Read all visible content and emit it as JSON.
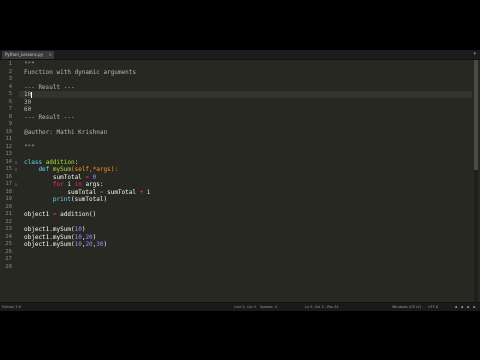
{
  "tab": {
    "label": "Python_Lessons.py",
    "close": "×"
  },
  "tabbar": {
    "arrow": "▾"
  },
  "status": {
    "language": "Python 3.6",
    "left_info": "Line 5, Col 3",
    "spaces": "Spaces: 4",
    "position": "Ln 5, Col 3 - Pos 34",
    "encoding_win": "Windows (CR LF)",
    "encoding": "UTF-8",
    "icons": [
      "▪",
      "▪",
      "▪",
      "▪"
    ]
  },
  "lines": [
    {
      "n": "1",
      "fold": "",
      "tokens": [
        {
          "t": "\"\"\"",
          "c": "c-comment"
        }
      ]
    },
    {
      "n": "2",
      "fold": "",
      "tokens": [
        {
          "t": "Function with dynamic arguments",
          "c": "c-comment"
        }
      ]
    },
    {
      "n": "3",
      "fold": "",
      "tokens": []
    },
    {
      "n": "4",
      "fold": "",
      "tokens": [
        {
          "t": "--- Result ---",
          "c": "c-comment"
        }
      ]
    },
    {
      "n": "5",
      "fold": "",
      "tokens": [
        {
          "t": "10",
          "c": "c-comment"
        }
      ],
      "cursor": true
    },
    {
      "n": "6",
      "fold": "",
      "tokens": [
        {
          "t": "30",
          "c": "c-comment"
        }
      ]
    },
    {
      "n": "7",
      "fold": "",
      "tokens": [
        {
          "t": "60",
          "c": "c-comment"
        }
      ]
    },
    {
      "n": "8",
      "fold": "",
      "tokens": [
        {
          "t": "--- Result ---",
          "c": "c-comment"
        }
      ]
    },
    {
      "n": "9",
      "fold": "",
      "tokens": []
    },
    {
      "n": "10",
      "fold": "",
      "tokens": [
        {
          "t": "@author: Mathi Krishnan",
          "c": "c-comment"
        }
      ]
    },
    {
      "n": "11",
      "fold": "",
      "tokens": []
    },
    {
      "n": "12",
      "fold": "",
      "tokens": [
        {
          "t": "\"\"\"",
          "c": "c-comment"
        }
      ]
    },
    {
      "n": "13",
      "fold": "",
      "tokens": []
    },
    {
      "n": "14",
      "fold": "⊟",
      "tokens": [
        {
          "t": "class ",
          "c": "c-def"
        },
        {
          "t": "addition",
          "c": "c-fn"
        },
        {
          "t": ":",
          "c": "c-txt"
        }
      ]
    },
    {
      "n": "15",
      "fold": "⊟",
      "tokens": [
        {
          "t": "    def ",
          "c": "c-def"
        },
        {
          "t": "mySum",
          "c": "c-fn"
        },
        {
          "t": "(self,*args):",
          "c": "c-arg"
        }
      ]
    },
    {
      "n": "16",
      "fold": "",
      "tokens": [
        {
          "t": "        sumTotal ",
          "c": "c-txt"
        },
        {
          "t": "=",
          "c": "c-kw"
        },
        {
          "t": " ",
          "c": "c-txt"
        },
        {
          "t": "0",
          "c": "c-num"
        }
      ]
    },
    {
      "n": "17",
      "fold": "⊟",
      "tokens": [
        {
          "t": "        for ",
          "c": "c-kw"
        },
        {
          "t": "i ",
          "c": "c-txt"
        },
        {
          "t": "in ",
          "c": "c-kw"
        },
        {
          "t": "args:",
          "c": "c-txt"
        }
      ]
    },
    {
      "n": "18",
      "fold": "",
      "tokens": [
        {
          "t": "            sumTotal ",
          "c": "c-txt"
        },
        {
          "t": "=",
          "c": "c-kw"
        },
        {
          "t": " sumTotal ",
          "c": "c-txt"
        },
        {
          "t": "+",
          "c": "c-kw"
        },
        {
          "t": " i",
          "c": "c-txt"
        }
      ]
    },
    {
      "n": "19",
      "fold": "",
      "tokens": [
        {
          "t": "        print",
          "c": "c-builtin"
        },
        {
          "t": "(sumTotal)",
          "c": "c-txt"
        }
      ]
    },
    {
      "n": "20",
      "fold": "",
      "tokens": []
    },
    {
      "n": "21",
      "fold": "",
      "tokens": [
        {
          "t": "object1 ",
          "c": "c-txt"
        },
        {
          "t": "=",
          "c": "c-kw"
        },
        {
          "t": " addition()",
          "c": "c-txt"
        }
      ]
    },
    {
      "n": "22",
      "fold": "",
      "tokens": []
    },
    {
      "n": "23",
      "fold": "",
      "tokens": [
        {
          "t": "object1.mySum(",
          "c": "c-txt"
        },
        {
          "t": "10",
          "c": "c-num"
        },
        {
          "t": ")",
          "c": "c-txt"
        }
      ]
    },
    {
      "n": "24",
      "fold": "",
      "tokens": [
        {
          "t": "object1.mySum(",
          "c": "c-txt"
        },
        {
          "t": "10",
          "c": "c-num"
        },
        {
          "t": ",",
          "c": "c-txt"
        },
        {
          "t": "20",
          "c": "c-num"
        },
        {
          "t": ")",
          "c": "c-txt"
        }
      ]
    },
    {
      "n": "25",
      "fold": "",
      "tokens": [
        {
          "t": "object1.mySum(",
          "c": "c-txt"
        },
        {
          "t": "10",
          "c": "c-num"
        },
        {
          "t": ",",
          "c": "c-txt"
        },
        {
          "t": "20",
          "c": "c-num"
        },
        {
          "t": ",",
          "c": "c-txt"
        },
        {
          "t": "30",
          "c": "c-num"
        },
        {
          "t": ")",
          "c": "c-txt"
        }
      ]
    },
    {
      "n": "26",
      "fold": "",
      "tokens": []
    },
    {
      "n": "27",
      "fold": "",
      "tokens": []
    },
    {
      "n": "28",
      "fold": "",
      "tokens": []
    }
  ]
}
